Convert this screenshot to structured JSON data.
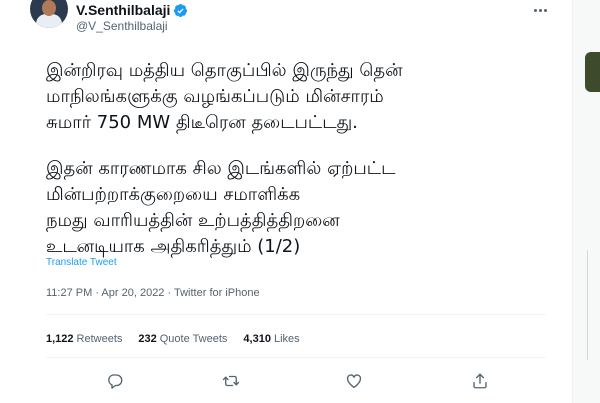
{
  "author": {
    "display_name": "V.Senthilbalaji",
    "handle": "@V_Senthilbalaji"
  },
  "tweet": {
    "paragraph1": [
      "இன்றிரவு மத்திய தொகுப்பில் இருந்து தென்",
      "மாநிலங்களுக்கு வழங்கப்படும் மின்சாரம்",
      "சுமார் 750 MW திடீரென தடைபட்டது."
    ],
    "paragraph2": [
      "இதன் காரணமாக சில இடங்களில் ஏற்பட்ட",
      "மின்பற்றாக்குறையை சமாளிக்க",
      "நமது வாரியத்தின் உற்பத்தித்திறனை",
      "உடனடியாக அதிகரித்தும் (1/2)"
    ],
    "translate_label": "Translate Tweet",
    "meta": "11:27 PM · Apr 20, 2022 · Twitter for iPhone"
  },
  "stats": {
    "retweets_count": "1,122",
    "retweets_label": "Retweets",
    "quotes_count": "232",
    "quotes_label": "Quote Tweets",
    "likes_count": "4,310",
    "likes_label": "Likes"
  },
  "colors": {
    "accent": "#1d9bf0",
    "muted": "#536471",
    "text": "#0f1419"
  },
  "icons": [
    "verified-badge-icon",
    "more-icon",
    "reply-icon",
    "retweet-icon",
    "like-icon",
    "share-icon"
  ]
}
